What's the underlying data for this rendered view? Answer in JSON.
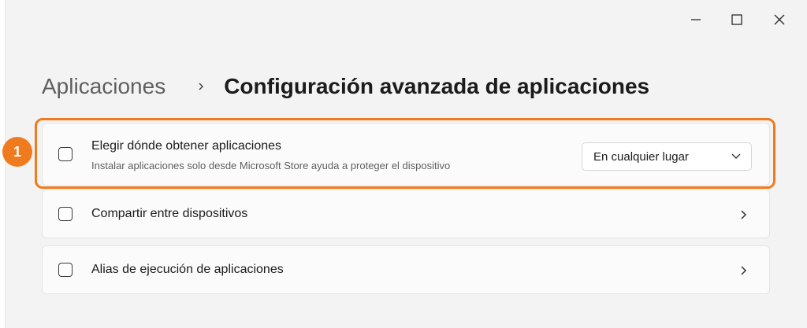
{
  "window": {
    "controls": [
      "minimize",
      "maximize",
      "close"
    ]
  },
  "breadcrumb": {
    "parent": "Aplicaciones",
    "current": "Configuración avanzada de aplicaciones"
  },
  "annotation": {
    "badge_number": "1",
    "accent_color": "#f07b1f"
  },
  "settings": [
    {
      "title": "Elegir dónde obtener aplicaciones",
      "description": "Instalar aplicaciones solo desde Microsoft Store ayuda a proteger el dispositivo",
      "control": "dropdown",
      "selected_option": "En cualquier lugar"
    },
    {
      "title": "Compartir entre dispositivos",
      "control": "chevron"
    },
    {
      "title": "Alias de ejecución de aplicaciones",
      "control": "chevron"
    }
  ],
  "icons": {
    "minimize": "minimize-icon",
    "maximize": "maximize-icon",
    "close": "close-icon",
    "breadcrumb_separator": "chevron-right-icon",
    "dropdown": "chevron-down-icon",
    "row_arrow": "chevron-right-icon"
  }
}
